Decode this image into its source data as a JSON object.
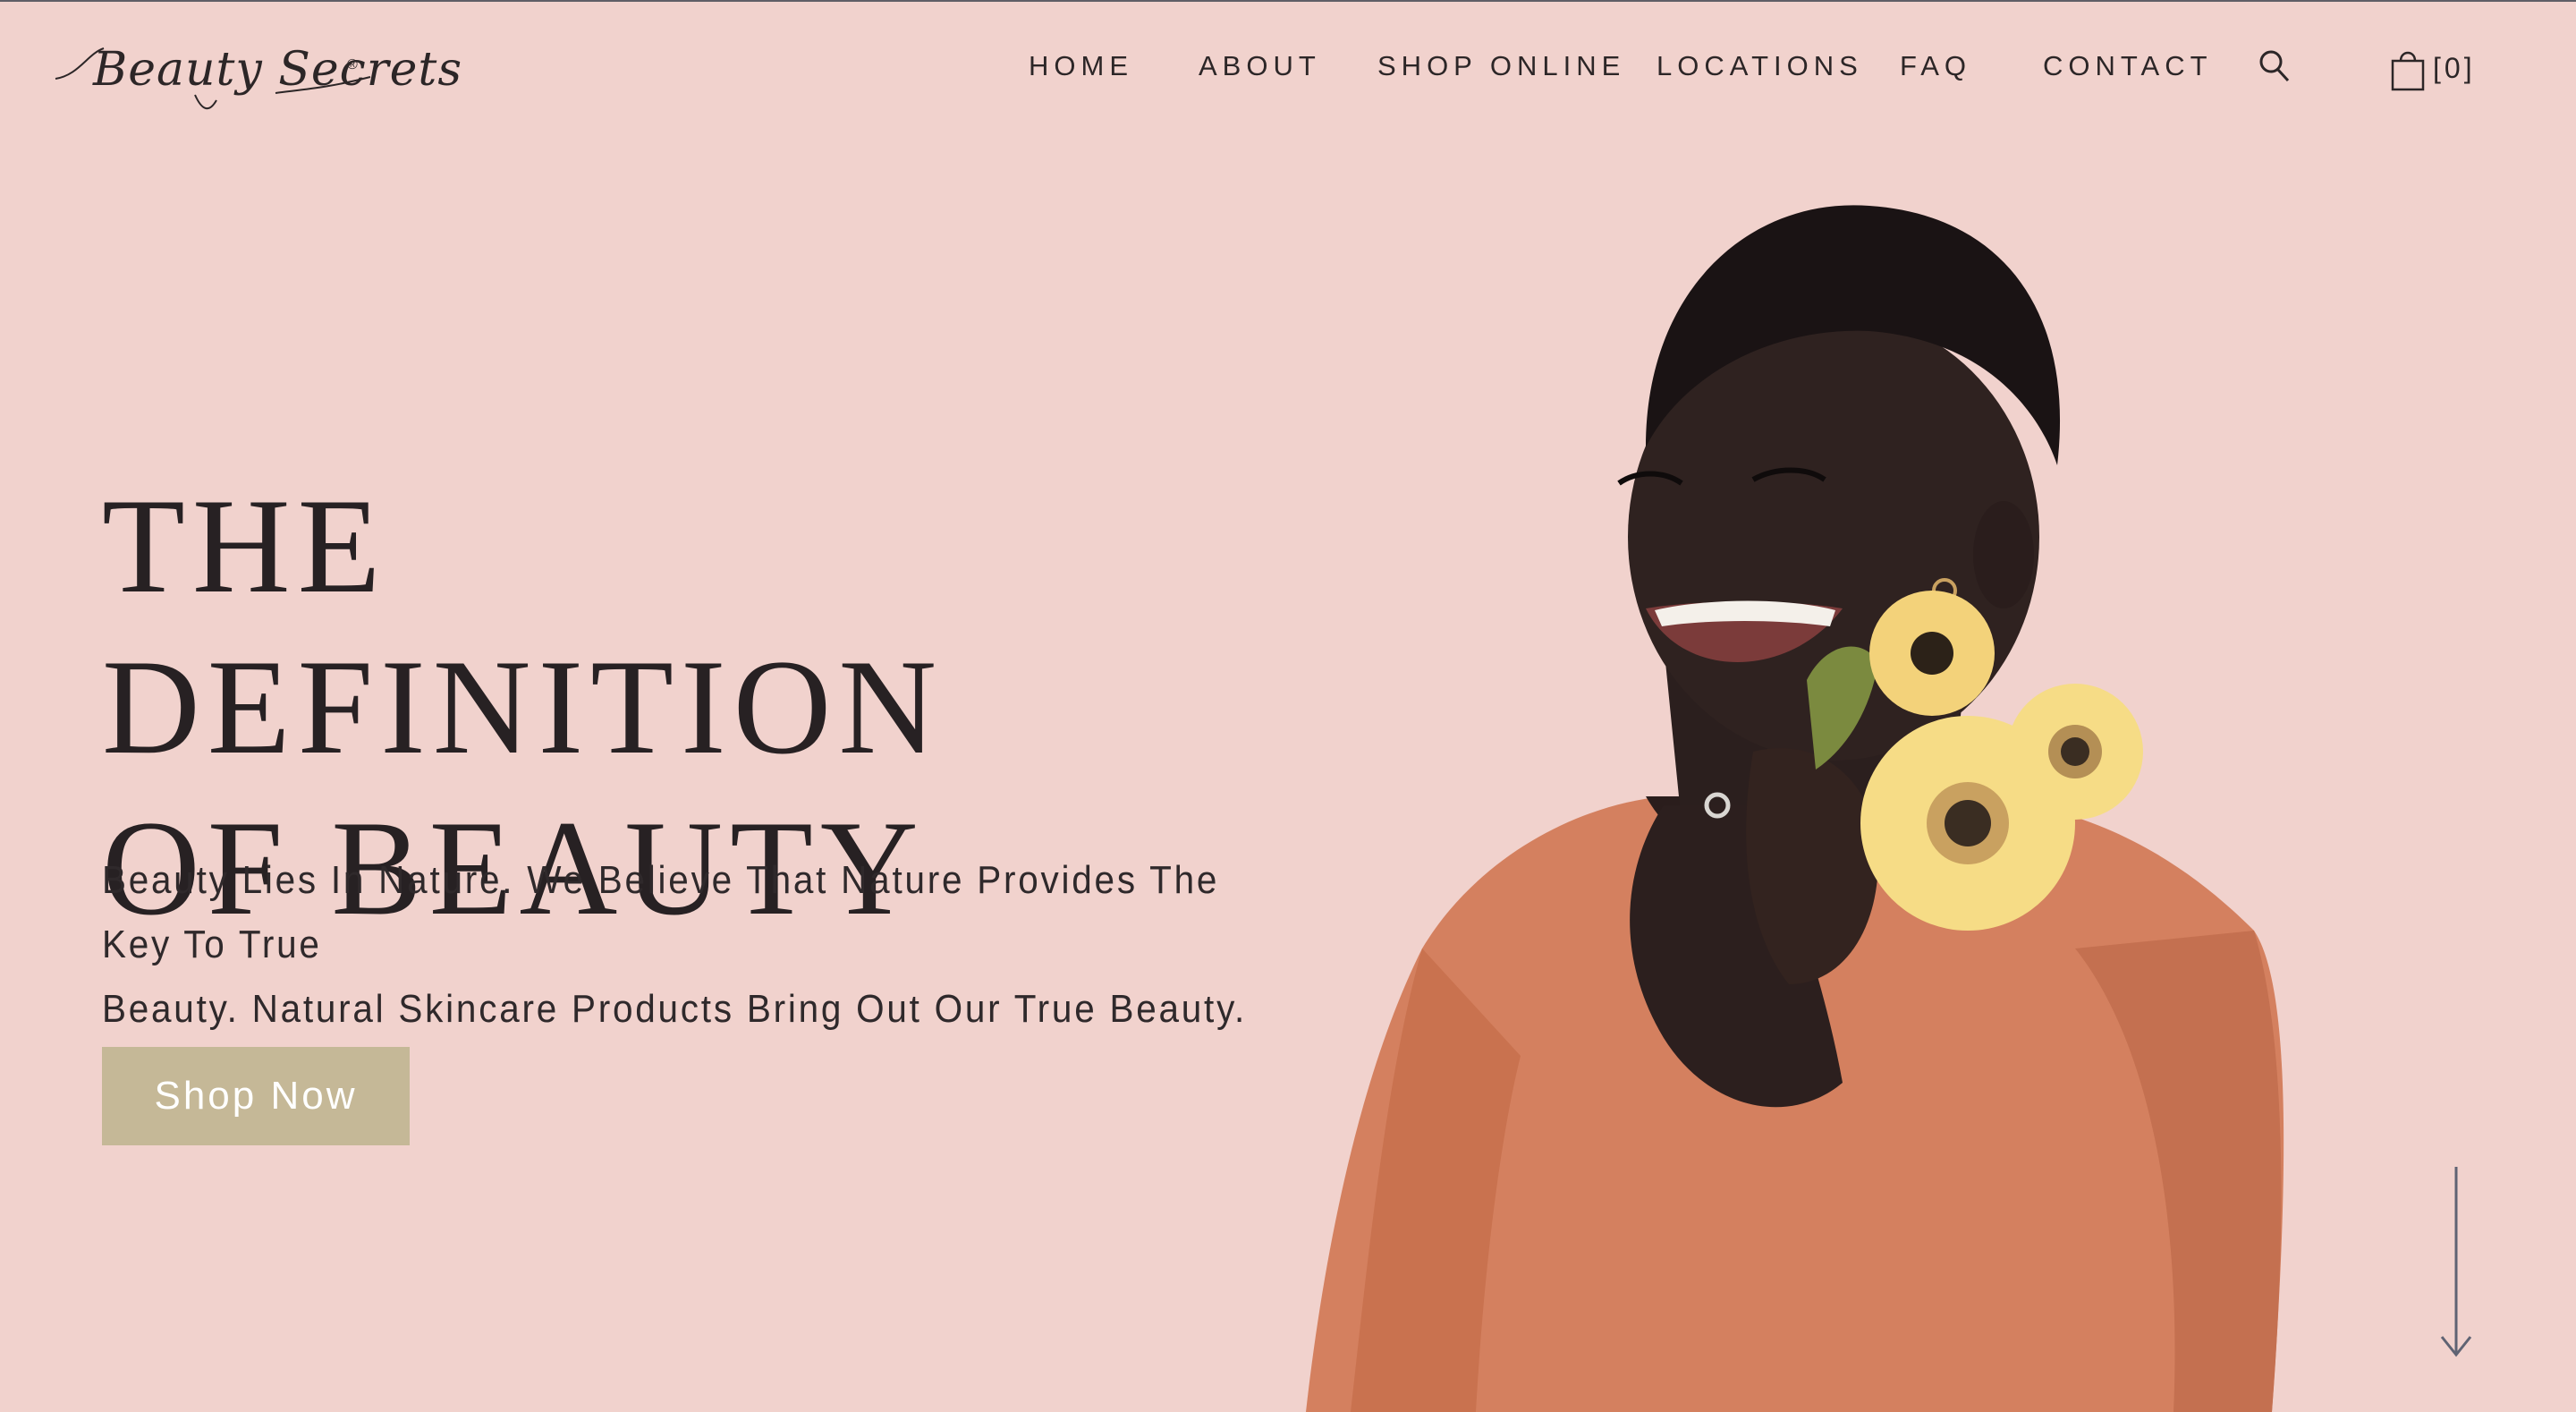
{
  "brand": {
    "logo_text": "Beauty Secrets",
    "registered_mark": "®"
  },
  "nav": {
    "items": [
      {
        "label": "HOME"
      },
      {
        "label": "ABOUT"
      },
      {
        "label": "SHOP ONLINE"
      },
      {
        "label": "LOCATIONS"
      },
      {
        "label": "FAQ"
      },
      {
        "label": "CONTACT"
      }
    ],
    "search_icon": "search-icon",
    "cart_icon": "shopping-bag-icon",
    "cart_count": "[0]"
  },
  "hero": {
    "headline_line1": "THE DEFINITION",
    "headline_line2": "OF BEAUTY",
    "subtext_line1": "Beauty Lies In Nature. We Believe That Nature Provides The Key To True",
    "subtext_line2": "Beauty. Natural Skincare Products Bring Out Our True Beauty.",
    "cta_label": "Shop Now",
    "scroll_icon": "arrow-down-icon"
  },
  "colors": {
    "background": "#f1d2cd",
    "cta_background": "#c5b897",
    "text": "#272123",
    "blouse": "#d4805f",
    "flower": "#f6dc86"
  }
}
